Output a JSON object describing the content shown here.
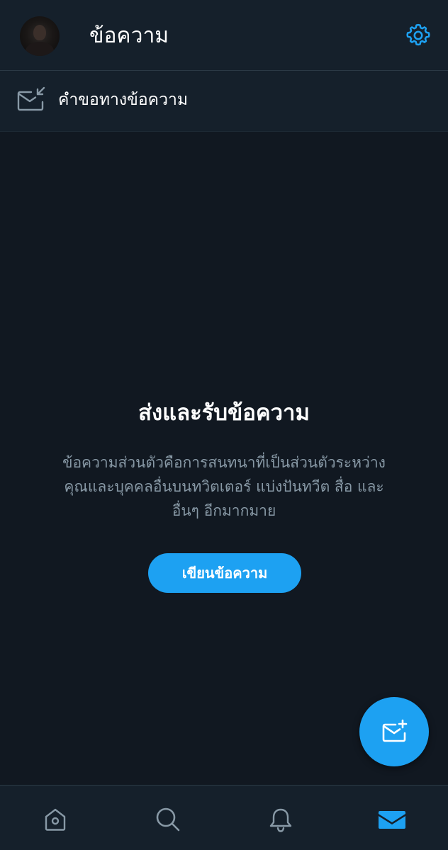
{
  "header": {
    "title": "ข้อความ",
    "avatar_icon": "user-avatar",
    "settings_icon": "gear-icon"
  },
  "requests": {
    "label": "คำขอทางข้อความ",
    "icon": "message-request-icon"
  },
  "empty_state": {
    "title": "ส่งและรับข้อความ",
    "description_lines": [
      "ข้อความส่วนตัวคือการสนทนาที่เป็นส่วนตัวระหว่าง",
      "คุณและบุคคลอื่นบนทวิตเตอร์ แบ่งปันทวีต สื่อ และ",
      "อื่นๆ อีกมากมาย"
    ],
    "button_label": "เขียนข้อความ"
  },
  "fab": {
    "icon": "new-message-icon"
  },
  "bottom_nav": {
    "items": [
      {
        "icon": "home-icon",
        "active": false
      },
      {
        "icon": "search-icon",
        "active": false
      },
      {
        "icon": "bell-icon",
        "active": false
      },
      {
        "icon": "mail-icon",
        "active": true
      }
    ]
  },
  "colors": {
    "accent": "#1da1f2",
    "background": "#111821",
    "surface": "#15202b",
    "muted_text": "#8899a6",
    "icon_inactive": "#8899a6"
  }
}
